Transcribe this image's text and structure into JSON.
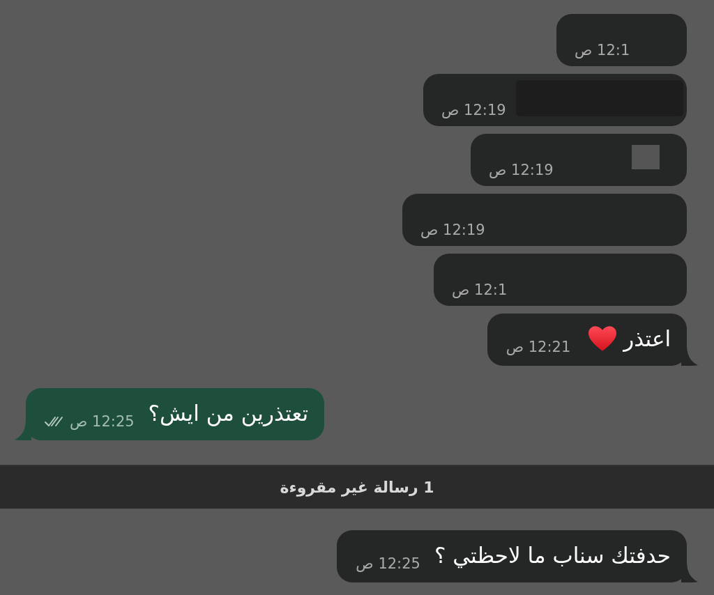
{
  "chat": [
    {
      "kind": "hidden",
      "outgoing": false,
      "tail": false,
      "time": "12:1 ص"
    },
    {
      "kind": "hidden",
      "outgoing": false,
      "tail": false,
      "time": "12:19 ص"
    },
    {
      "kind": "hidden",
      "outgoing": false,
      "tail": false,
      "time": "12:19 ص"
    },
    {
      "kind": "hidden",
      "outgoing": false,
      "tail": false,
      "time": "12:19 ص"
    },
    {
      "kind": "hidden",
      "outgoing": false,
      "tail": false,
      "time": "12:1 ص"
    },
    {
      "kind": "emoji",
      "outgoing": false,
      "tail": true,
      "text": "اعتذر",
      "time": "12:21 ص"
    },
    {
      "kind": "text",
      "outgoing": true,
      "tail": true,
      "text": "تعتذرين من ايش؟",
      "time": "12:25 ص",
      "read": true
    },
    {
      "kind": "divider",
      "label": "1 رسالة غير مقروءة"
    },
    {
      "kind": "text",
      "outgoing": false,
      "tail": true,
      "text": "حدفتك سناب ما لاحظتي ؟",
      "time": "12:25 ص"
    }
  ]
}
